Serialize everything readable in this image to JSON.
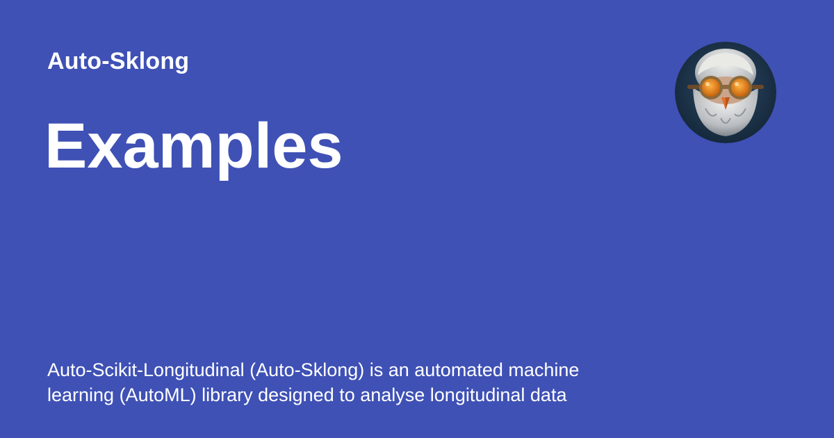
{
  "site": {
    "name": "Auto-Sklong"
  },
  "page": {
    "title": "Examples",
    "description": "Auto-Scikit-Longitudinal (Auto-Sklong) is an automated machine learning (AutoML) library designed to analyse longitudinal data"
  },
  "logo": {
    "icon": "bearded-owl-with-goggles-icon"
  },
  "colors": {
    "background": "#3f51b5",
    "text": "#ffffff",
    "logo_background": "#1c3448",
    "goggle_lens": "#f08a1a"
  }
}
